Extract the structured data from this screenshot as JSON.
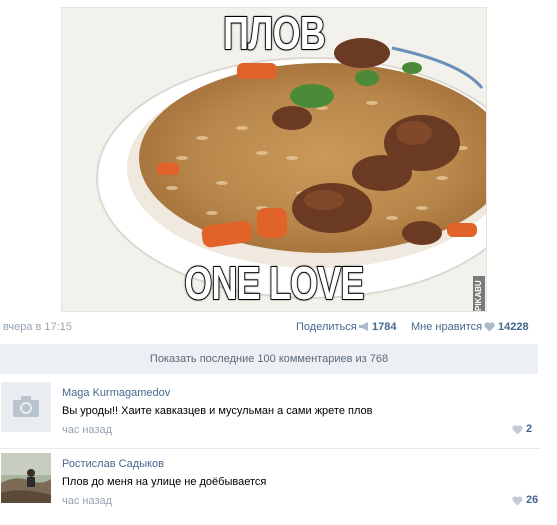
{
  "post": {
    "meme_top": "ПЛОВ",
    "meme_bottom": "ONE LOVE",
    "watermark": "PIKABU",
    "time": "вчера в 17:15",
    "share_label": "Поделиться",
    "share_count": "1784",
    "like_label": "Мне нравится",
    "like_count": "14228"
  },
  "show_comments": {
    "label": "Показать последние 100 комментариев из 768"
  },
  "comments": [
    {
      "author": "Maga Kurmagamedov",
      "text": "Вы уроды!! Хаите кавказцев и мусульман а сами жрете плов",
      "time": "час назад",
      "likes": "2",
      "avatar": "camera-placeholder-icon"
    },
    {
      "author": "Ростислав Садыков",
      "text": "Плов до меня на улице не доёбывается",
      "time": "час назад",
      "likes": "26",
      "avatar": "user-photo"
    }
  ],
  "colors": {
    "link": "#45688e",
    "muted": "#97a4b1",
    "bar_bg": "#eceff3"
  }
}
